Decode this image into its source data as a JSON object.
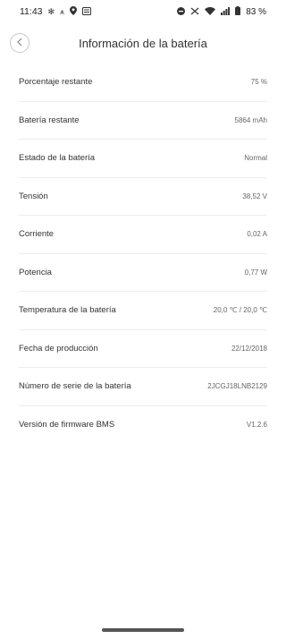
{
  "status_bar": {
    "time": "11:43",
    "battery_percent": "83 %"
  },
  "header": {
    "title": "Información de la batería"
  },
  "rows": [
    {
      "label": "Porcentaje restante",
      "value": "75 %"
    },
    {
      "label": "Batería restante",
      "value": "5864 mAh"
    },
    {
      "label": "Estado de la batería",
      "value": "Normal"
    },
    {
      "label": "Tensión",
      "value": "38,52 V"
    },
    {
      "label": "Corriente",
      "value": "0,02 A"
    },
    {
      "label": "Potencia",
      "value": "0,77 W"
    },
    {
      "label": "Temperatura de la batería",
      "value": "20,0 ℃ / 20,0 ℃"
    },
    {
      "label": "Fecha de producción",
      "value": "22/12/2018"
    },
    {
      "label": "Número de serie de la batería",
      "value": "2JCGJ18LNB2129"
    },
    {
      "label": "Versión de firmware BMS",
      "value": "V1.2.6"
    }
  ],
  "icons": {
    "back": "chevron-left-icon",
    "status_left": [
      "settings-gear-icon",
      "fan-icon",
      "location-pin-icon",
      "message-icon"
    ],
    "status_right": [
      "do-not-disturb-icon",
      "volte-icon",
      "wifi-icon",
      "cell-signal-icon",
      "battery-icon"
    ]
  }
}
